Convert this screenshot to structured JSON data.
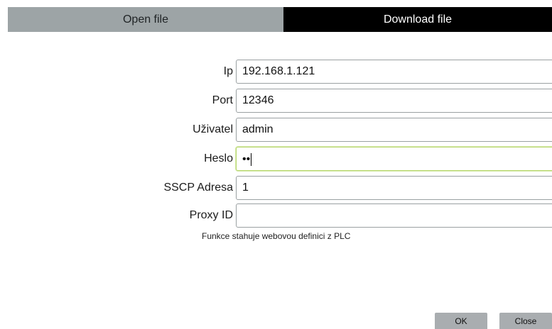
{
  "tabs": {
    "open_label": "Open file",
    "download_label": "Download file"
  },
  "form": {
    "ip": {
      "label": "Ip",
      "value": "192.168.1.121"
    },
    "port": {
      "label": "Port",
      "value": "12346"
    },
    "user": {
      "label": "Uživatel",
      "value": "admin"
    },
    "password": {
      "label": "Heslo",
      "masked_value": "••"
    },
    "sscp": {
      "label": "SSCP Adresa",
      "value": "1"
    },
    "proxy": {
      "label": "Proxy ID",
      "value": ""
    }
  },
  "note": "Funkce stahuje webovou definici z PLC",
  "buttons": {
    "ok_label": "OK",
    "close_label": "Close"
  },
  "colors": {
    "tab_inactive": "#9da4a6",
    "tab_active": "#000000",
    "focus_border": "#b6d66a",
    "button_bg": "#a9adb0"
  }
}
